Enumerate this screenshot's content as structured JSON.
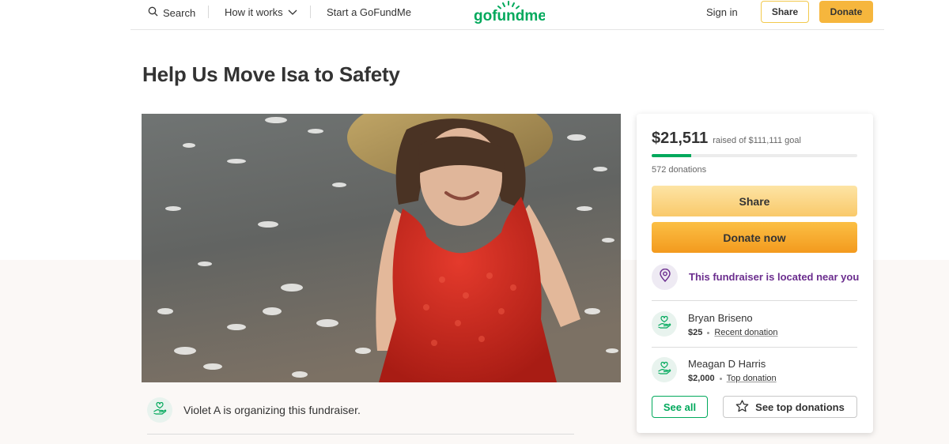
{
  "header": {
    "search_label": "Search",
    "how_it_works_label": "How it works",
    "start_label": "Start a GoFundMe",
    "logo_text": "gofundme",
    "sign_in_label": "Sign in",
    "share_label": "Share",
    "donate_label": "Donate"
  },
  "campaign": {
    "title": "Help Us Move Isa to Safety",
    "organizer_text": "Violet A is organizing this fundraiser."
  },
  "donation_card": {
    "raised_amount": "$21,511",
    "raised_goal": "raised of $111,111 goal",
    "progress_fraction": 0.1936,
    "donations_count": "572 donations",
    "share_label": "Share",
    "donate_now_label": "Donate now",
    "location_text": "This fundraiser is located near you",
    "donors": [
      {
        "name": "Bryan Briseno",
        "amount": "$25",
        "tag": "Recent donation"
      },
      {
        "name": "Meagan D Harris",
        "amount": "$2,000",
        "tag": "Top donation"
      }
    ],
    "see_all_label": "See all",
    "see_top_label": "See top donations"
  },
  "colors": {
    "brand_green": "#02a95c",
    "donate_orange": "#f6b63d",
    "location_purple": "#6b2d8e"
  },
  "icons": [
    "search-icon",
    "chevron-down-icon",
    "location-pin-icon",
    "donor-hand-heart-icon",
    "star-icon"
  ]
}
